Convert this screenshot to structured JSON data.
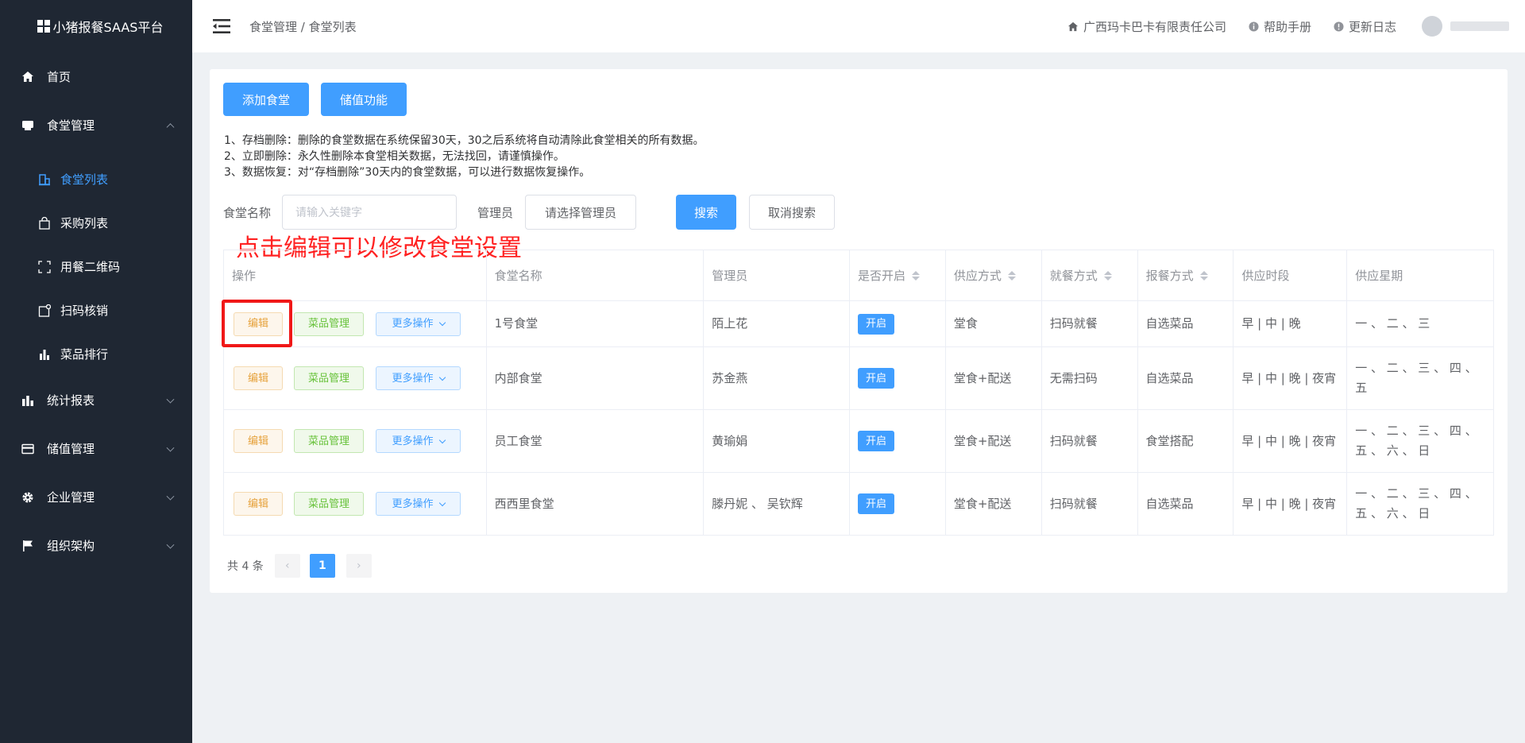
{
  "brand": {
    "title": "小猪报餐SAAS平台"
  },
  "sidebar": {
    "items": [
      {
        "label": "首页",
        "icon": "home-icon"
      },
      {
        "label": "食堂管理",
        "icon": "canteen-icon"
      },
      {
        "label": "统计报表",
        "icon": "bar-chart-icon"
      },
      {
        "label": "储值管理",
        "icon": "card-icon"
      },
      {
        "label": "企业管理",
        "icon": "gear-icon"
      },
      {
        "label": "组织架构",
        "icon": "flag-icon"
      }
    ],
    "subitems": [
      {
        "label": "食堂列表",
        "icon": "building-icon"
      },
      {
        "label": "采购列表",
        "icon": "bag-icon"
      },
      {
        "label": "用餐二维码",
        "icon": "scan-frame-icon"
      },
      {
        "label": "扫码核销",
        "icon": "scan-check-icon"
      },
      {
        "label": "菜品排行",
        "icon": "rank-bars-icon"
      }
    ]
  },
  "header": {
    "breadcrumb": "食堂管理 / 食堂列表",
    "company": "广西玛卡巴卡有限责任公司",
    "help": "帮助手册",
    "changelog": "更新日志"
  },
  "toolbar": {
    "add_canteen": "添加食堂",
    "stored_value": "储值功能"
  },
  "notes": [
    "1、存档删除：删除的食堂数据在系统保留30天，30之后系统将自动清除此食堂相关的所有数据。",
    "2、立即删除：永久性删除本食堂相关数据，无法找回，请谨慎操作。",
    "3、数据恢复：对“存档删除”30天内的食堂数据，可以进行数据恢复操作。"
  ],
  "filters": {
    "name_label": "食堂名称",
    "name_placeholder": "请输入关键字",
    "admin_label": "管理员",
    "admin_select": "请选择管理员",
    "search": "搜索",
    "cancel_search": "取消搜索"
  },
  "annotation": "点击编辑可以修改食堂设置",
  "table": {
    "headers": [
      "操作",
      "食堂名称",
      "管理员",
      "是否开启",
      "供应方式",
      "就餐方式",
      "报餐方式",
      "供应时段",
      "供应星期"
    ],
    "action_labels": {
      "edit": "编辑",
      "menu": "菜品管理",
      "more": "更多操作"
    },
    "rows": [
      {
        "name": "1号食堂",
        "admin": "陌上花",
        "enabled": "开启",
        "supply": "堂食",
        "dining": "扫码就餐",
        "order": "自选菜品",
        "periods": "早 | 中 | 晚",
        "weekdays": "一 、 二 、 三"
      },
      {
        "name": "内部食堂",
        "admin": "苏金燕",
        "enabled": "开启",
        "supply": "堂食+配送",
        "dining": "无需扫码",
        "order": "自选菜品",
        "periods": "早 | 中 | 晚 | 夜宵",
        "weekdays": "一 、 二 、 三 、 四 、 五"
      },
      {
        "name": "员工食堂",
        "admin": "黄瑜娟",
        "enabled": "开启",
        "supply": "堂食+配送",
        "dining": "扫码就餐",
        "order": "食堂搭配",
        "periods": "早 | 中 | 晚 | 夜宵",
        "weekdays": "一 、 二 、 三 、 四 、 五 、 六 、 日"
      },
      {
        "name": "西西里食堂",
        "admin": "滕丹妮 、 吴钦辉",
        "enabled": "开启",
        "supply": "堂食+配送",
        "dining": "扫码就餐",
        "order": "自选菜品",
        "periods": "早 | 中 | 晚 | 夜宵",
        "weekdays": "一 、 二 、 三 、 四 、 五 、 六 、 日"
      }
    ]
  },
  "pagination": {
    "total": "共 4 条",
    "current": "1",
    "prev": "‹",
    "next": "›"
  },
  "colors": {
    "sidebar_bg": "#1f2733",
    "primary": "#409eff",
    "annotation": "#ff2222"
  }
}
